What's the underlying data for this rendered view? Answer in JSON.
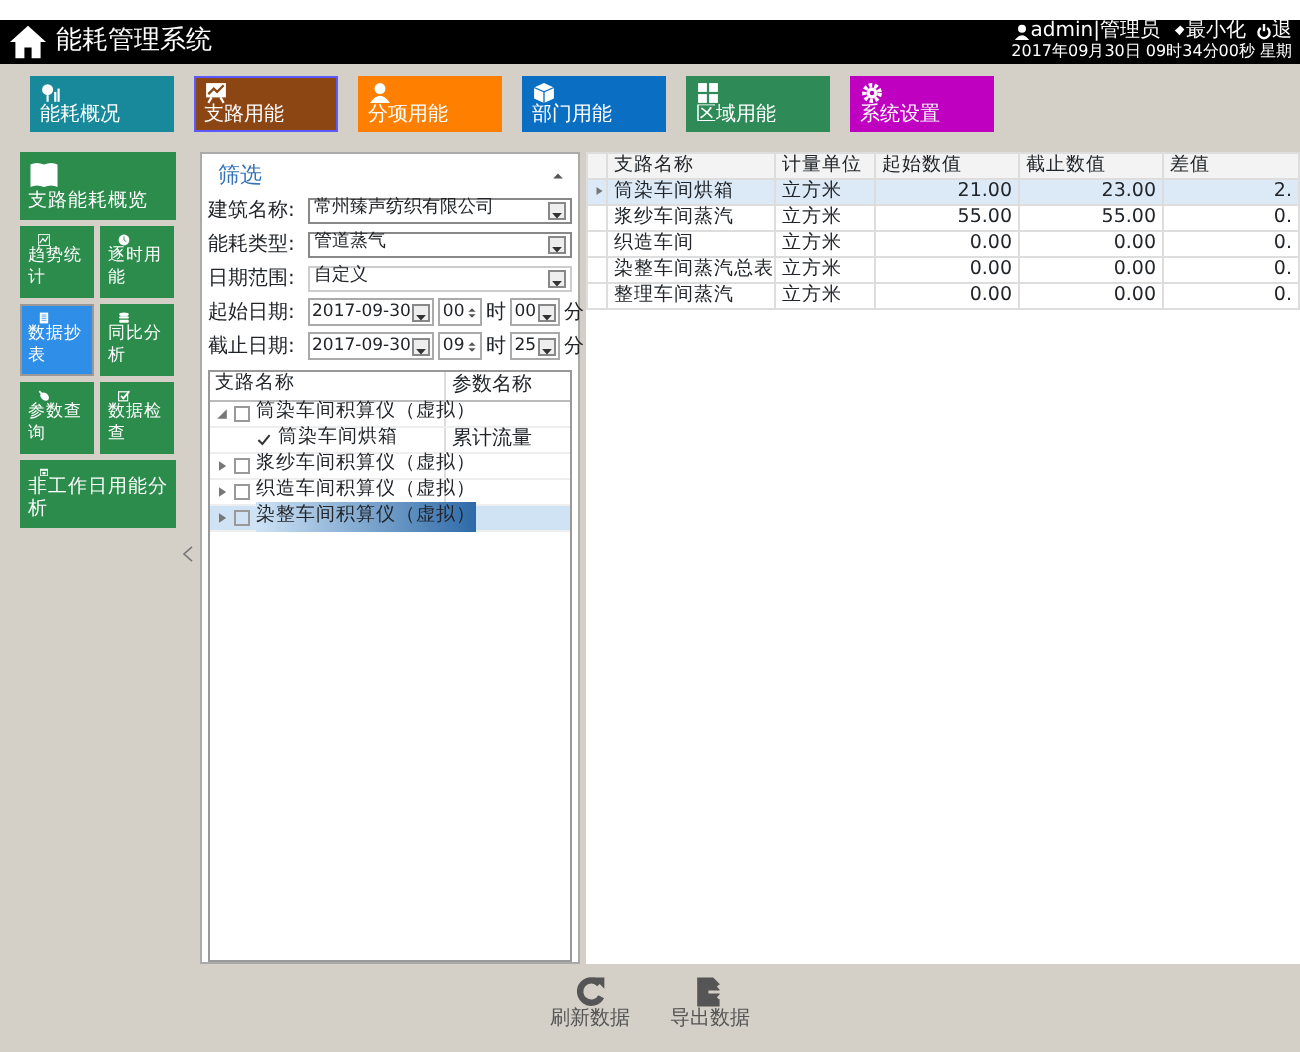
{
  "header": {
    "title": "能耗管理系统",
    "user": "admin|管理员",
    "minimize": "最小化",
    "exit": "退",
    "datetime": "2017年09月30日 09时34分00秒 星期"
  },
  "nav": [
    {
      "label": "能耗概况",
      "color": "#17899a",
      "selected": false
    },
    {
      "label": "支路用能",
      "color": "#8b4614",
      "selected": true
    },
    {
      "label": "分项用能",
      "color": "#ff8000",
      "selected": false
    },
    {
      "label": "部门用能",
      "color": "#0a6fc2",
      "selected": false
    },
    {
      "label": "区域用能",
      "color": "#2e8b57",
      "selected": false
    },
    {
      "label": "系统设置",
      "color": "#c000c0",
      "selected": false
    }
  ],
  "sidebar": [
    {
      "label": "支路能耗概览",
      "kind": "wide",
      "selected": false
    },
    {
      "label": "趋势统计",
      "kind": "small",
      "selected": false
    },
    {
      "label": "逐时用能",
      "kind": "small",
      "selected": false
    },
    {
      "label": "数据抄表",
      "kind": "small",
      "selected": true
    },
    {
      "label": "同比分析",
      "kind": "small",
      "selected": false
    },
    {
      "label": "参数查询",
      "kind": "small",
      "selected": false
    },
    {
      "label": "数据检查",
      "kind": "small",
      "selected": false
    },
    {
      "label": "非工作日用能分析",
      "kind": "wide",
      "selected": false
    }
  ],
  "filter": {
    "title": "筛选",
    "fields": [
      {
        "kind": "select",
        "label": "建筑名称:",
        "value": "常州臻声纺织有限公司"
      },
      {
        "kind": "select",
        "label": "能耗类型:",
        "value": "管道蒸气"
      },
      {
        "kind": "range",
        "label": "日期范围:",
        "value": "自定义"
      },
      {
        "kind": "datetime",
        "label": "起始日期:",
        "date": "2017-09-30",
        "hour": "00",
        "hour_unit": "时",
        "minute": "00",
        "minute_unit": "分"
      },
      {
        "kind": "datetime",
        "label": "截止日期:",
        "date": "2017-09-30",
        "hour": "09",
        "hour_unit": "时",
        "minute": "25",
        "minute_unit": "分"
      }
    ],
    "tree": {
      "columns": [
        "支路名称",
        "参数名称"
      ],
      "rows": [
        {
          "label": "筒染车间积算仪（虚拟）",
          "checked": false,
          "expanded": true,
          "selected": false,
          "param": "",
          "children": [
            {
              "label": "筒染车间烘箱",
              "checked": true,
              "selected": false,
              "param": "累计流量"
            }
          ]
        },
        {
          "label": "浆纱车间积算仪（虚拟）",
          "checked": false,
          "expanded": false,
          "selected": false,
          "param": ""
        },
        {
          "label": "织造车间积算仪（虚拟）",
          "checked": false,
          "expanded": false,
          "selected": false,
          "param": ""
        },
        {
          "label": "染整车间积算仪（虚拟）",
          "checked": false,
          "expanded": false,
          "selected": true,
          "param": ""
        }
      ]
    }
  },
  "table": {
    "columns": [
      "支路名称",
      "计量单位",
      "起始数值",
      "截止数值",
      "差值"
    ],
    "rows": [
      {
        "cells": [
          "筒染车间烘箱",
          "立方米",
          "21.00",
          "23.00",
          "2."
        ],
        "selected": true
      },
      {
        "cells": [
          "浆纱车间蒸汽",
          "立方米",
          "55.00",
          "55.00",
          "0."
        ],
        "selected": false
      },
      {
        "cells": [
          "织造车间",
          "立方米",
          "0.00",
          "0.00",
          "0."
        ],
        "selected": false
      },
      {
        "cells": [
          "染整车间蒸汽总表",
          "立方米",
          "0.00",
          "0.00",
          "0."
        ],
        "selected": false
      },
      {
        "cells": [
          "整理车间蒸汽",
          "立方米",
          "0.00",
          "0.00",
          "0."
        ],
        "selected": false
      }
    ]
  },
  "actions": [
    {
      "label": "刷新数据"
    },
    {
      "label": "导出数据"
    }
  ]
}
